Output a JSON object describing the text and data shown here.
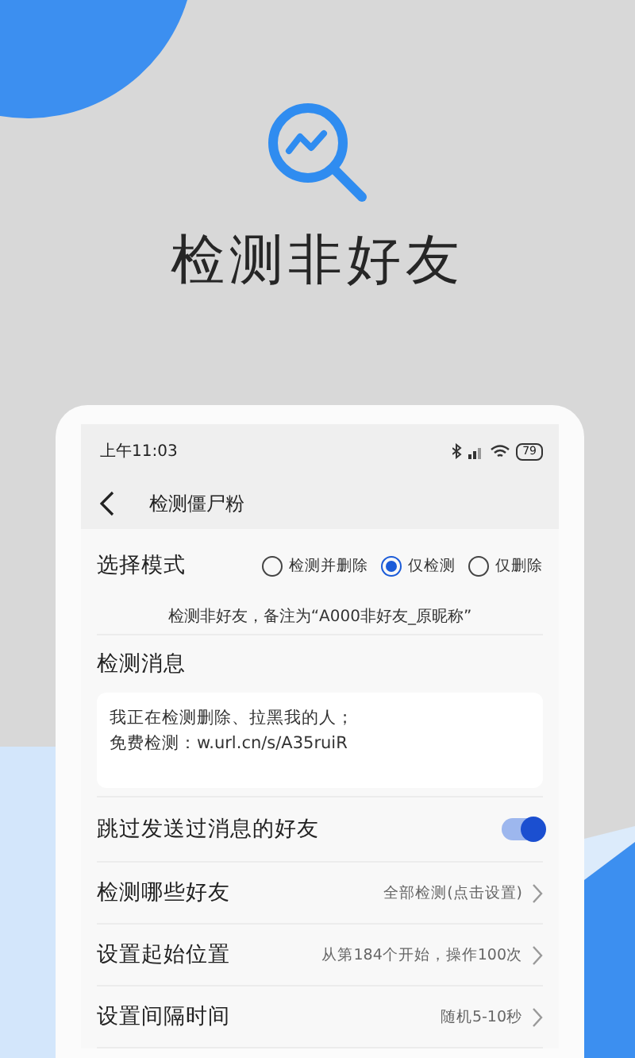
{
  "headline": {
    "title": "检测非好友"
  },
  "phone": {
    "status_bar": {
      "time": "上午11:03",
      "battery": "79"
    },
    "nav": {
      "title": "检测僵尸粉"
    },
    "mode": {
      "label": "选择模式",
      "options": [
        {
          "label": "检测并删除",
          "selected": false
        },
        {
          "label": "仅检测",
          "selected": true
        },
        {
          "label": "仅删除",
          "selected": false
        }
      ]
    },
    "mode_hint": "检测非好友，备注为“A000非好友_原昵称”",
    "message": {
      "label": "检测消息",
      "lines": [
        "我正在检测删除、拉黑我的人；",
        "免费检测：w.url.cn/s/A35ruiR"
      ]
    },
    "settings": [
      {
        "kind": "toggle",
        "label": "跳过发送过消息的好友",
        "on": true
      },
      {
        "kind": "link",
        "label": "检测哪些好友",
        "value": "全部检测(点击设置)"
      },
      {
        "kind": "link",
        "label": "设置起始位置",
        "value": "从第184个开始，操作100次"
      },
      {
        "kind": "link",
        "label": "设置间隔时间",
        "value": "随机5-10秒"
      }
    ]
  }
}
